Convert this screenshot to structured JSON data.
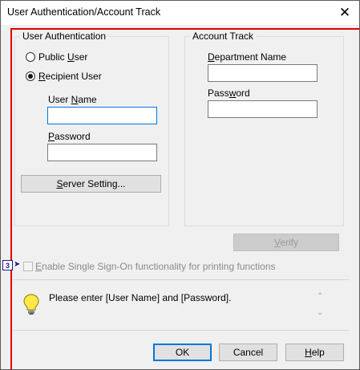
{
  "window": {
    "title": "User Authentication/Account Track",
    "close_glyph": "✕"
  },
  "user_auth": {
    "group_label": "User Authentication",
    "public_user_label": {
      "pre": "Public ",
      "key": "U",
      "post": "ser"
    },
    "recipient_user_label": {
      "pre": "",
      "key": "R",
      "post": "ecipient User"
    },
    "selected": "recipient",
    "user_name_label": {
      "pre": "User ",
      "key": "N",
      "post": "ame"
    },
    "user_name_value": "",
    "password_label": {
      "pre": "",
      "key": "P",
      "post": "assword"
    },
    "password_value": "",
    "server_setting_label": {
      "pre": "",
      "key": "S",
      "post": "erver Setting..."
    }
  },
  "account_track": {
    "group_label": "Account Track",
    "department_label": {
      "pre": "",
      "key": "D",
      "post": "epartment Name"
    },
    "department_value": "",
    "password_label": {
      "pre": "Pass",
      "key": "w",
      "post": "ord"
    },
    "password_value": ""
  },
  "verify_label": {
    "pre": "",
    "key": "V",
    "post": "erify"
  },
  "sso": {
    "label_pre": "",
    "label_key": "E",
    "label_post": "nable Single Sign-On functionality for printing functions",
    "checked": false,
    "marker": "3"
  },
  "message": {
    "icon": "lightbulb-icon",
    "text": "Please enter [User Name] and [Password]."
  },
  "buttons": {
    "ok": "OK",
    "cancel": "Cancel",
    "help": {
      "pre": "",
      "key": "H",
      "post": "elp"
    }
  },
  "colors": {
    "accent": "#0078d7",
    "highlight_frame": "#e00000",
    "bulb": "#ffe94a"
  }
}
